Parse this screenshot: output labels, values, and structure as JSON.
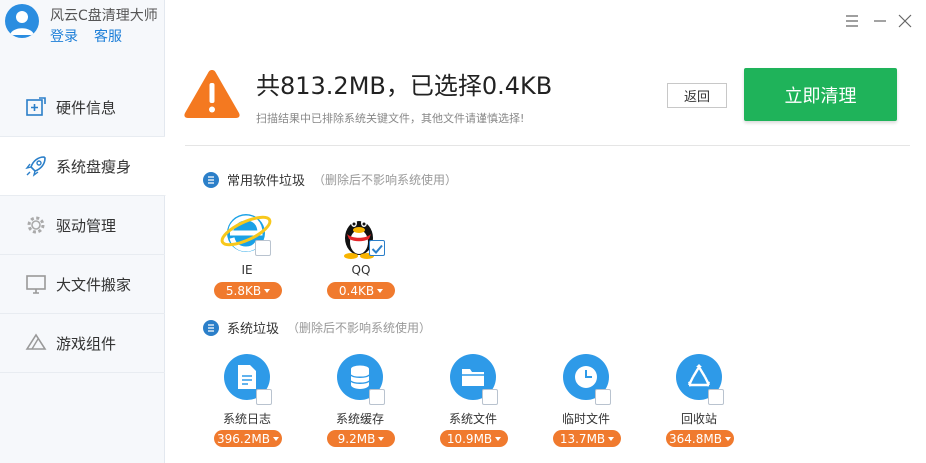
{
  "app": {
    "title": "风云C盘清理大师",
    "login": "登录",
    "service": "客服"
  },
  "nav": {
    "items": [
      {
        "label": "硬件信息",
        "icon": "hardware-icon",
        "active": false
      },
      {
        "label": "系统盘瘦身",
        "icon": "rocket-icon",
        "active": true
      },
      {
        "label": "驱动管理",
        "icon": "gear-icon",
        "active": false
      },
      {
        "label": "大文件搬家",
        "icon": "monitor-icon",
        "active": false
      },
      {
        "label": "游戏组件",
        "icon": "game-icon",
        "active": false
      }
    ]
  },
  "header": {
    "headline": "共813.2MB，已选择0.4KB",
    "subline": "扫描结果中已排除系统关键文件，其他文件请谨慎选择!",
    "back_label": "返回",
    "clean_label": "立即清理"
  },
  "sections": [
    {
      "title": "常用软件垃圾",
      "note": "（删除后不影响系统使用）",
      "items": [
        {
          "name": "IE",
          "size": "5.8KB",
          "icon": "ie-icon",
          "checked": false
        },
        {
          "name": "QQ",
          "size": "0.4KB",
          "icon": "qq-icon",
          "checked": true
        }
      ]
    },
    {
      "title": "系统垃圾",
      "note": "（删除后不影响系统使用）",
      "items": [
        {
          "name": "系统日志",
          "size": "396.2MB",
          "icon": "log-file-icon",
          "checked": false
        },
        {
          "name": "系统缓存",
          "size": "9.2MB",
          "icon": "database-icon",
          "checked": false
        },
        {
          "name": "系统文件",
          "size": "10.9MB",
          "icon": "folder-icon",
          "checked": false
        },
        {
          "name": "临时文件",
          "size": "13.7MB",
          "icon": "clock-icon",
          "checked": false
        },
        {
          "name": "回收站",
          "size": "364.8MB",
          "icon": "recycle-icon",
          "checked": false
        }
      ]
    }
  ],
  "colors": {
    "accent_blue": "#2e9ae8",
    "clean_green": "#1fb35a",
    "size_orange": "#f07a2e",
    "warn_orange": "#f47920"
  }
}
